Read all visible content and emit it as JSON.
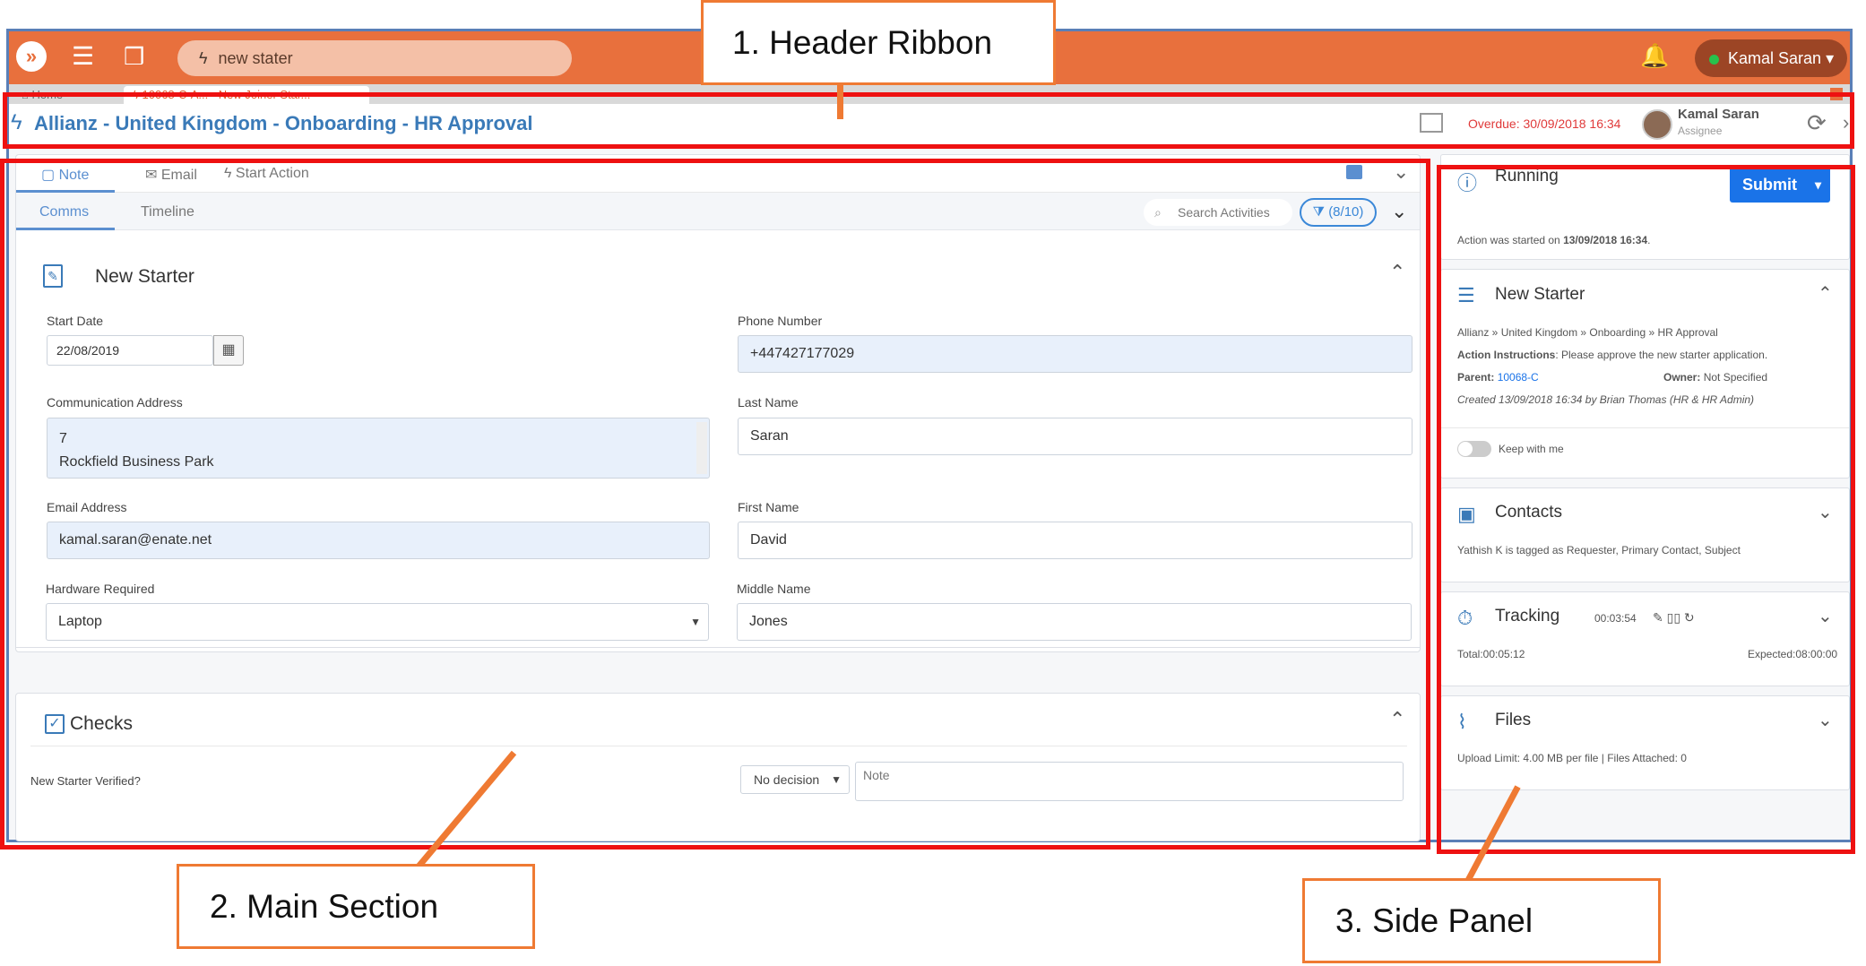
{
  "header": {
    "search_text": "new stater",
    "user": "Kamal Saran"
  },
  "tabs": {
    "home": "Home",
    "active": "10068-C-A... - New Joiner Star..."
  },
  "title_bar": {
    "title": "Allianz - United Kingdom - Onboarding - HR Approval",
    "overdue": "Overdue: 30/09/2018 16:34",
    "assignee_name": "Kamal Saran",
    "assignee_role": "Assignee"
  },
  "main": {
    "tabs_top": [
      "Note",
      "Email",
      "Start Action"
    ],
    "tabs_sub": [
      "Comms",
      "Timeline"
    ],
    "search_placeholder": "Search Activities",
    "filter_label": "(8/10)",
    "new_starter": {
      "title": "New Starter",
      "start_date_label": "Start Date",
      "start_date": "22/08/2019",
      "phone_label": "Phone Number",
      "phone": "+447427177029",
      "address_label": "Communication Address",
      "address_line1": "7",
      "address_line2": "Rockfield Business Park",
      "last_name_label": "Last Name",
      "last_name": "Saran",
      "email_label": "Email Address",
      "email": "kamal.saran@enate.net",
      "first_name_label": "First Name",
      "first_name": "David",
      "hardware_label": "Hardware Required",
      "hardware": "Laptop",
      "middle_name_label": "Middle Name",
      "middle_name": "Jones"
    },
    "checks": {
      "title": "Checks",
      "question": "New Starter Verified?",
      "decision": "No decision",
      "note_placeholder": "Note"
    }
  },
  "side": {
    "status": "Running",
    "submit": "Submit",
    "started_prefix": "Action was started on ",
    "started_time": "13/09/2018 16:34",
    "started_suffix": ".",
    "ns_title": "New Starter",
    "breadcrumb": "Allianz » United Kingdom » Onboarding » HR Approval",
    "instructions_label": "Action Instructions",
    "instructions": ": Please approve the new starter application.",
    "parent_label": "Parent:",
    "parent": "10068-C",
    "owner_label": "Owner:",
    "owner": "Not Specified",
    "created": "Created 13/09/2018 16:34 by Brian Thomas (HR & HR Admin)",
    "keep_with_me": "Keep with me",
    "contacts_title": "Contacts",
    "contacts_text": "Yathish K is tagged as Requester, Primary Contact, Subject",
    "tracking_title": "Tracking",
    "tracking_time": "00:03:54",
    "total": "Total:00:05:12",
    "expected": "Expected:08:00:00",
    "files_title": "Files",
    "files_text": "Upload Limit: 4.00 MB per file | Files Attached: 0"
  },
  "annotations": {
    "header_ribbon": "1. Header Ribbon",
    "main_section": "2. Main Section",
    "side_panel": "3. Side Panel"
  },
  "colors": {
    "brand_orange": "#e8703d",
    "link_blue": "#3a7ab8",
    "submit_blue": "#1a73e8",
    "annotation_red": "#ee1111",
    "annotation_orange": "#ef7a33"
  }
}
